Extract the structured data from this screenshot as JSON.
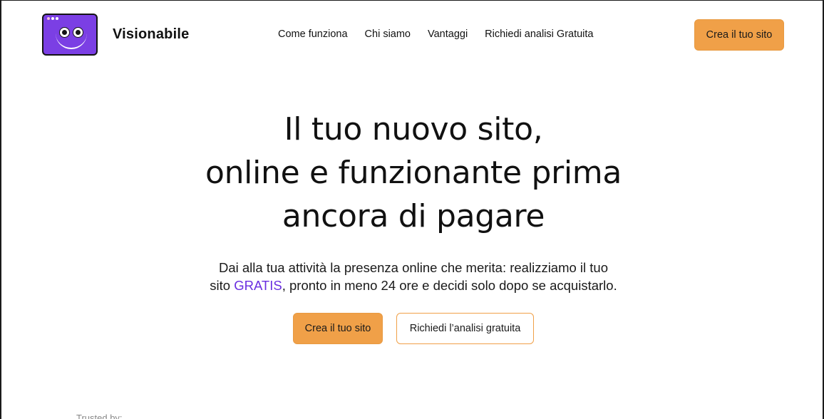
{
  "brand": {
    "name": "Visionabile",
    "logo_icon": "smiley-window-logo-icon",
    "logo_color": "#7b3fe4"
  },
  "nav": {
    "items": [
      {
        "label": "Come funziona"
      },
      {
        "label": "Chi siamo"
      },
      {
        "label": "Vantaggi"
      },
      {
        "label": "Richiedi analisi Gratuita"
      }
    ],
    "cta_label": "Crea il tuo sito"
  },
  "hero": {
    "title_lines": [
      "Il tuo nuovo sito,",
      "online e funzionante prima",
      "ancora di pagare"
    ],
    "subtitle_line1": "Dai alla tua attività la presenza online che merita: realizziamo il tuo",
    "subtitle_line2_before": "sito ",
    "subtitle_highlight": "GRATIS",
    "subtitle_line2_after": ", pronto in meno 24 ore e decidi solo dopo se acquistarlo.",
    "primary_cta": "Crea il tuo sito",
    "secondary_cta": "Richiedi l’analisi gratuita"
  },
  "trusted": {
    "label": "Trusted by:"
  },
  "colors": {
    "accent_orange": "#f0a048",
    "highlight_purple": "#6a2ee0",
    "text": "#111111"
  }
}
